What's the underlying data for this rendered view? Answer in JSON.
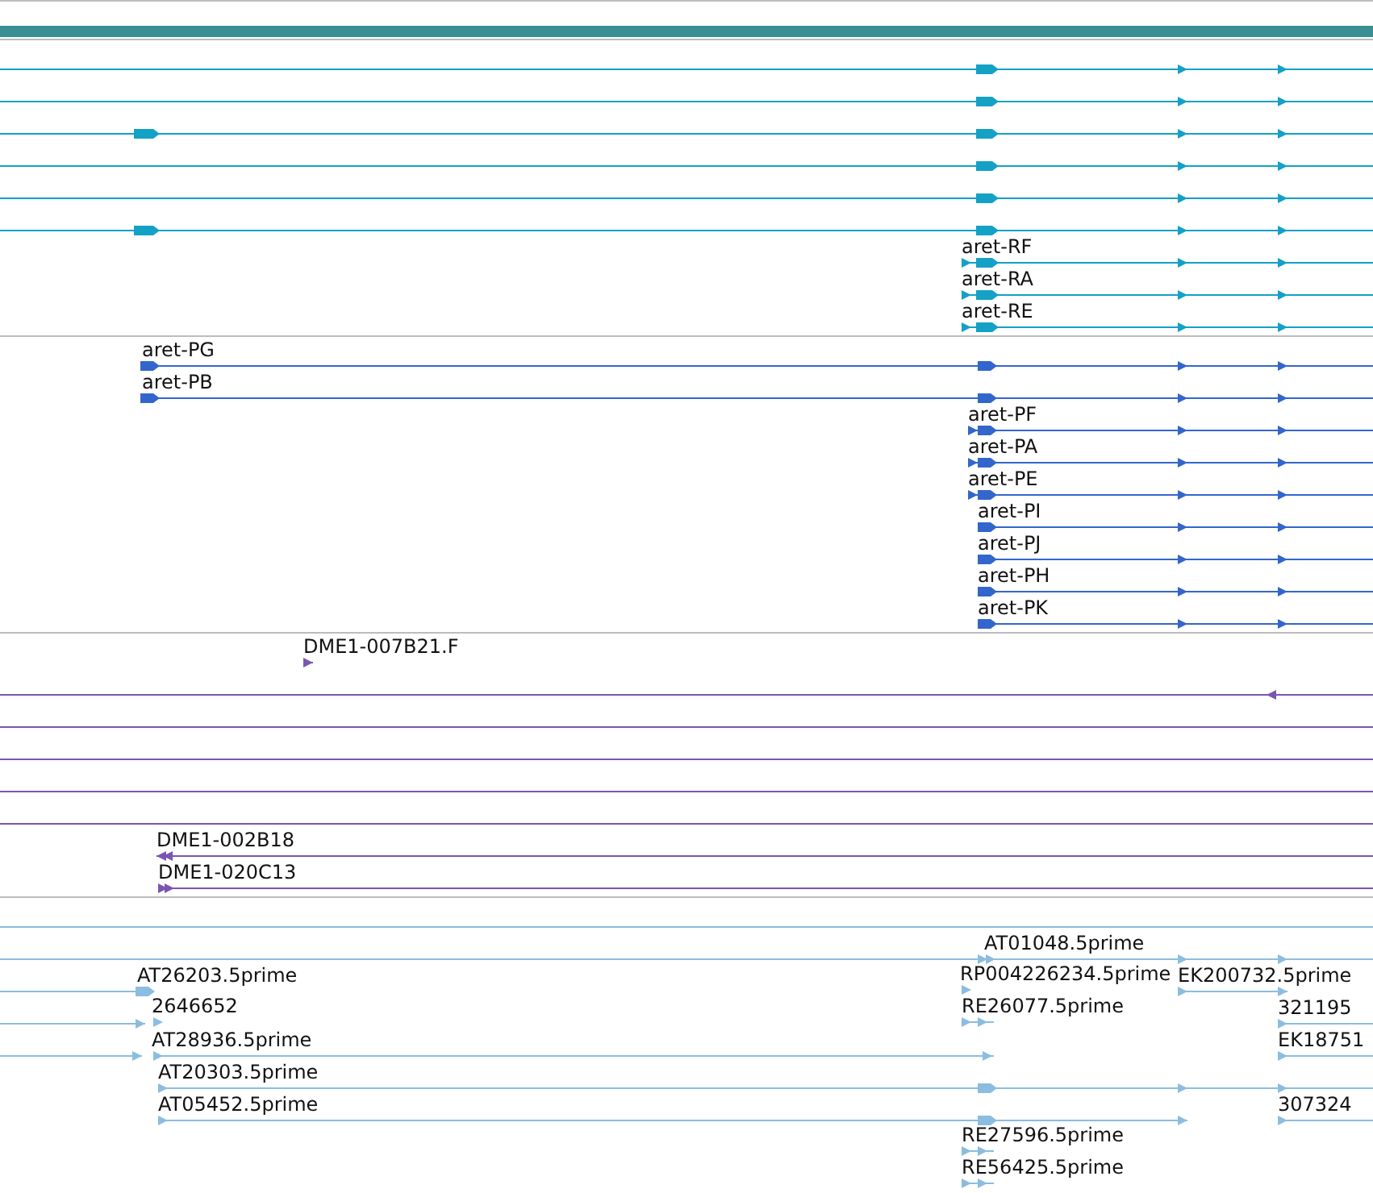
{
  "tracks": [
    {
      "kind": "bar",
      "color": "#3a8f94"
    },
    {
      "kind": "features",
      "color": "#13a1c6",
      "features": [
        {
          "kind": "line"
        },
        {
          "kind": "line"
        },
        {
          "kind": "line"
        },
        {
          "kind": "line"
        },
        {
          "kind": "line"
        },
        {
          "kind": "line"
        },
        {
          "kind": "line",
          "label": "aret-RF"
        },
        {
          "kind": "line",
          "label": "aret-RA"
        },
        {
          "kind": "line",
          "label": "aret-RE"
        }
      ]
    },
    {
      "kind": "features",
      "color": "#3366cc",
      "features": [
        {
          "kind": "line",
          "label": "aret-PG"
        },
        {
          "kind": "line",
          "label": "aret-PB"
        },
        {
          "kind": "line",
          "label": "aret-PF"
        },
        {
          "kind": "line",
          "label": "aret-PA"
        },
        {
          "kind": "line",
          "label": "aret-PE"
        },
        {
          "kind": "line",
          "label": "aret-PI"
        },
        {
          "kind": "line",
          "label": "aret-PJ"
        },
        {
          "kind": "line",
          "label": "aret-PH"
        },
        {
          "kind": "line",
          "label": "aret-PK"
        }
      ]
    },
    {
      "kind": "features",
      "color": "#7a56b0",
      "features": [
        {
          "kind": "line",
          "label": "DME1-007B21.F"
        },
        {
          "kind": "line"
        },
        {
          "kind": "line"
        },
        {
          "kind": "line"
        },
        {
          "kind": "line"
        },
        {
          "kind": "line"
        },
        {
          "kind": "line",
          "label": "DME1-002B18"
        },
        {
          "kind": "line",
          "label": "DME1-020C13"
        }
      ]
    },
    {
      "kind": "features",
      "color": "#8bbde0",
      "features": [
        {
          "kind": "line"
        },
        {
          "kind": "line",
          "label": "AT01048.5prime"
        },
        {
          "kind": "line",
          "label": "AT26203.5prime"
        },
        {
          "kind": "line",
          "label": "RP004226234.5prime"
        },
        {
          "kind": "line",
          "label": "EK200732.5prime"
        },
        {
          "kind": "line"
        },
        {
          "kind": "line",
          "label": "2646652"
        },
        {
          "kind": "line",
          "label": "RE26077.5prime"
        },
        {
          "kind": "line",
          "label": "321195"
        },
        {
          "kind": "line"
        },
        {
          "kind": "line",
          "label": "AT28936.5prime"
        },
        {
          "kind": "line",
          "label": "EK18751"
        },
        {
          "kind": "line",
          "label": "AT20303.5prime"
        },
        {
          "kind": "line",
          "label": "AT05452.5prime"
        },
        {
          "kind": "line",
          "label": "307324"
        },
        {
          "kind": "line",
          "label": "RE27596.5prime"
        },
        {
          "kind": "line",
          "label": "RE56425.5prime"
        }
      ]
    }
  ]
}
